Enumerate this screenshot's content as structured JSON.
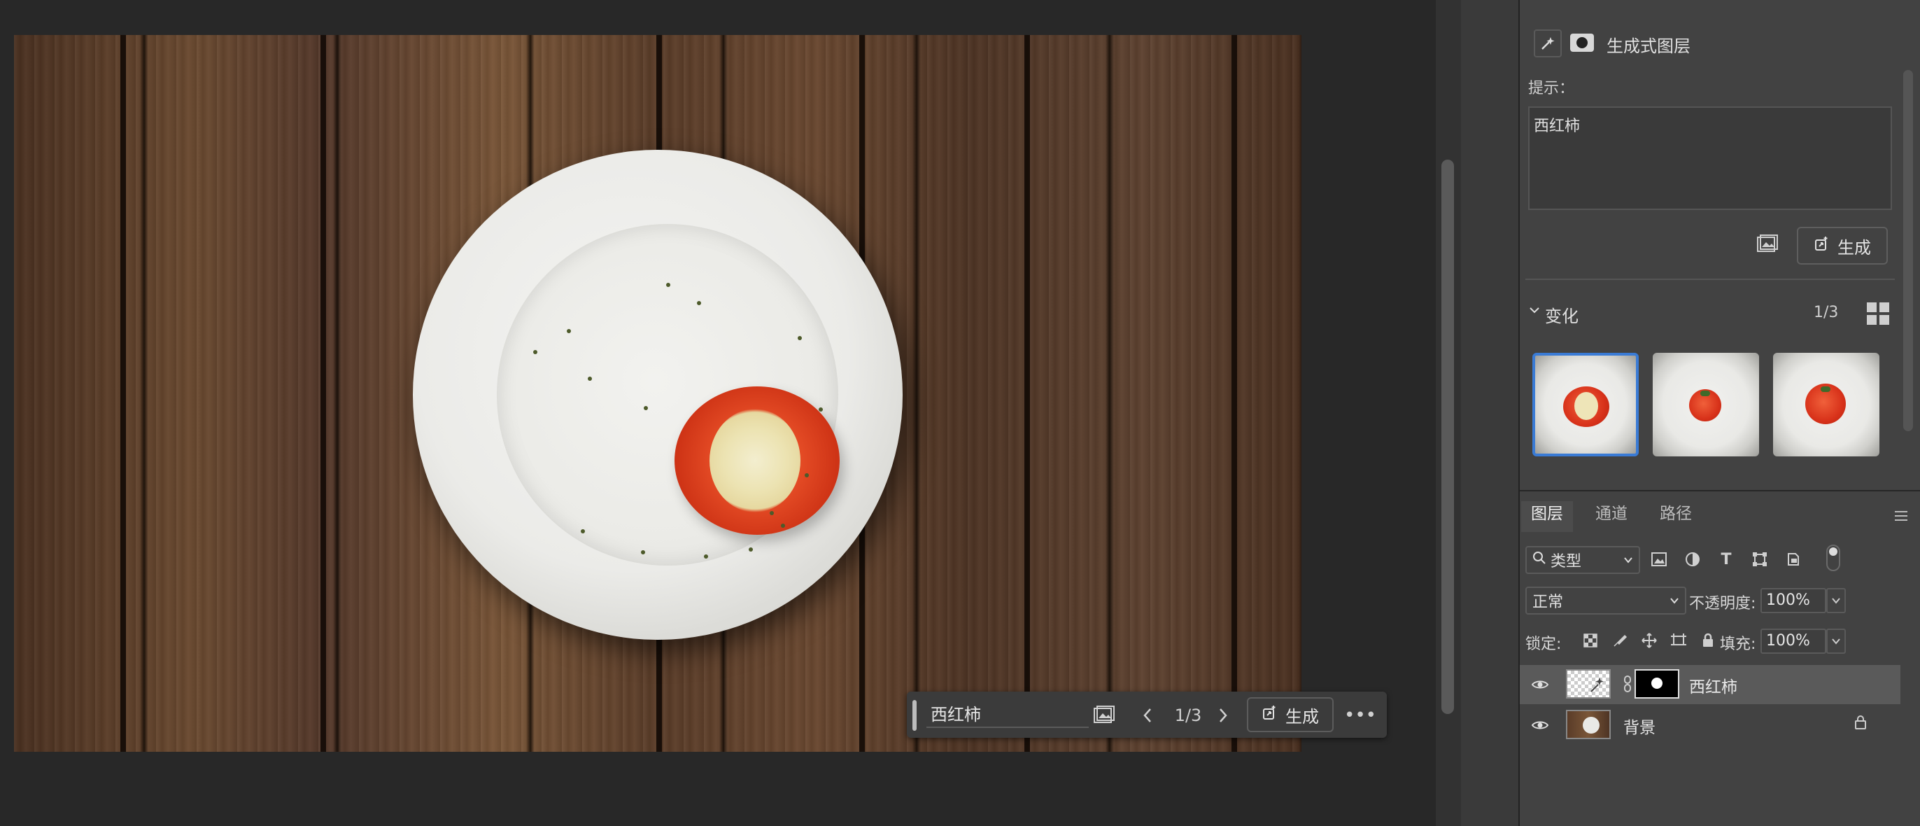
{
  "canvas": {
    "taskbar": {
      "prompt_value": "西红柿",
      "counter": "1/3",
      "generate_label": "生成"
    }
  },
  "properties": {
    "layer_kind": "生成式图层",
    "prompt_label": "提示：",
    "prompt_value": "西红柿",
    "generate_label": "生成",
    "variations_title": "变化",
    "variations_count": "1/3",
    "variations_selected_index": 0
  },
  "layers": {
    "tabs": [
      {
        "label": "图层",
        "active": true
      },
      {
        "label": "通道",
        "active": false
      },
      {
        "label": "路径",
        "active": false
      }
    ],
    "filter_label": "类型",
    "blend_mode": "正常",
    "opacity_label": "不透明度:",
    "opacity_value": "100%",
    "lock_label": "锁定:",
    "fill_label": "填充:",
    "fill_value": "100%",
    "items": [
      {
        "name": "西红柿",
        "selected": true
      },
      {
        "name": "背景",
        "selected": false
      }
    ]
  },
  "colors": {
    "selection_accent": "#3a7bd5",
    "panel_bg": "#424242",
    "canvas_bg": "#282828"
  }
}
